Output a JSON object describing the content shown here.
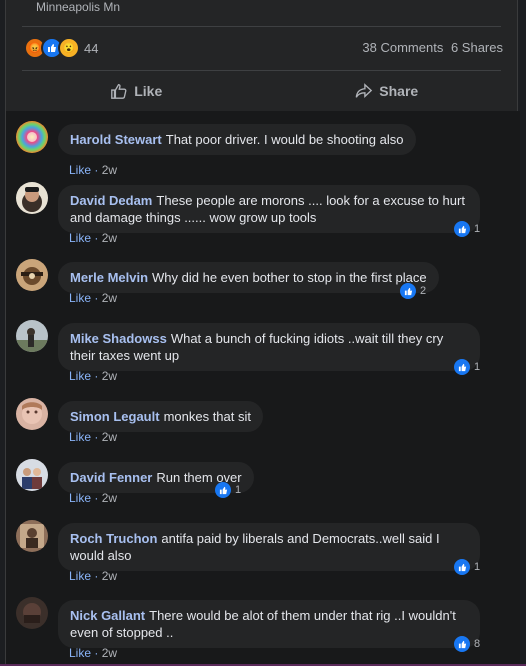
{
  "post": {
    "location": "Minneapolis Mn",
    "reaction_count": "44",
    "comments_count": "38 Comments",
    "shares_count": "6 Shares",
    "like_label": "Like",
    "share_label": "Share"
  },
  "comments": [
    {
      "author": "Harold Stewart",
      "text": "That poor driver. I would be shooting also",
      "like": "Like",
      "time": "2w",
      "likes": ""
    },
    {
      "author": "David Dedam",
      "text": "These people are morons .... look for a excuse to hurt and damage things ...... wow grow up tools",
      "like": "Like",
      "time": "2w",
      "likes": "1"
    },
    {
      "author": "Merle Melvin",
      "text": "Why did he even bother to stop in the first place",
      "like": "Like",
      "time": "2w",
      "likes": "2"
    },
    {
      "author": "Mike Shadowss",
      "text": "What a bunch of fucking idiots ..wait till they cry their taxes went up",
      "like": "Like",
      "time": "2w",
      "likes": "1"
    },
    {
      "author": "Simon Legault",
      "text": "monkes that sit",
      "like": "Like",
      "time": "2w",
      "likes": ""
    },
    {
      "author": "David Fenner",
      "text": "Run them over",
      "like": "Like",
      "time": "2w",
      "likes": "1"
    },
    {
      "author": "Roch Truchon",
      "text": "antifa paid by liberals and Democrats..well said I would also",
      "like": "Like",
      "time": "2w",
      "likes": "1"
    },
    {
      "author": "Nick Gallant",
      "text": "There would be alot of them under that rig ..I wouldn't even of stopped ..",
      "like": "Like",
      "time": "2w",
      "likes": "8"
    }
  ],
  "colors": {
    "accent": "#1877f2",
    "link": "#a8c0f0"
  }
}
